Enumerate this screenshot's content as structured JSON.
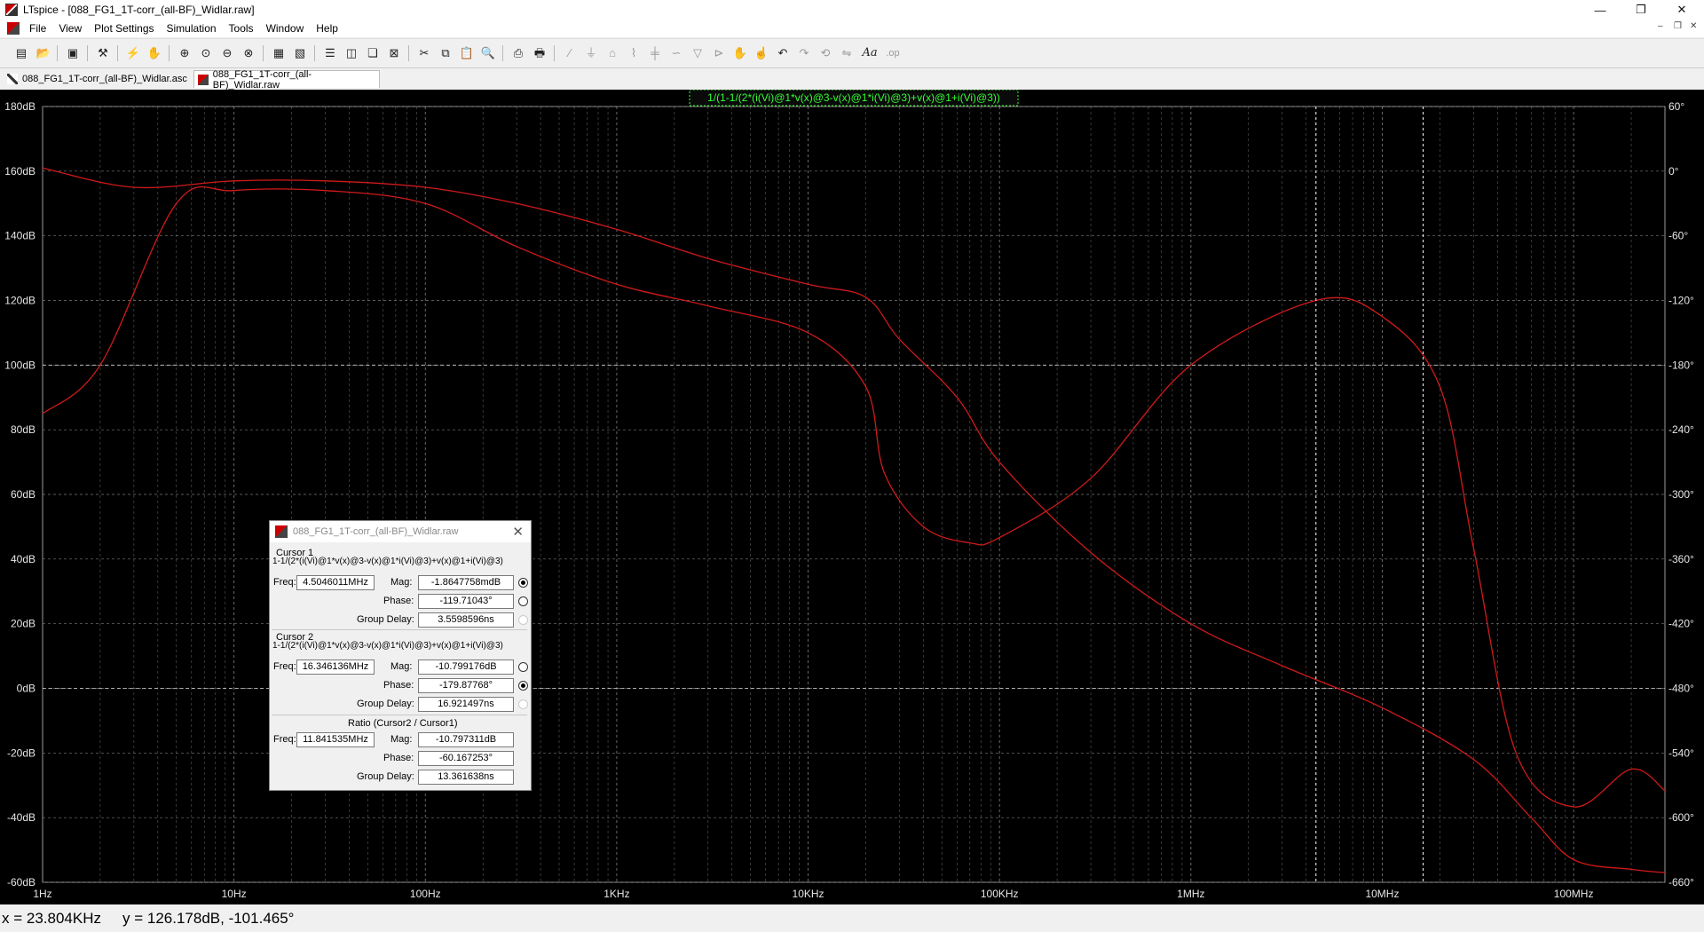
{
  "window": {
    "title": "LTspice - [088_FG1_1T-corr_(all-BF)_Widlar.raw]",
    "minimize": "—",
    "restore": "❐",
    "close": "✕"
  },
  "menu": [
    "File",
    "View",
    "Plot Settings",
    "Simulation",
    "Tools",
    "Window",
    "Help"
  ],
  "mdi_controls": {
    "minimize": "–",
    "restore": "❐",
    "close": "✕"
  },
  "tabs": [
    {
      "label": "088_FG1_1T-corr_(all-BF)_Widlar.asc",
      "icon": "schematic-icon"
    },
    {
      "label": "088_FG1_1T-corr_(all-BF)_Widlar.raw",
      "icon": "waveform-icon"
    }
  ],
  "toolbar_icons": [
    "new-schematic-icon",
    "open-icon",
    "save-icon",
    "control-panel-icon",
    "run-icon",
    "halt-icon",
    "zoom-in-icon",
    "zoom-pan-icon",
    "zoom-out-icon",
    "zoom-cancel-icon",
    "autorange-icon",
    "manual-limits-icon",
    "tile-horizontal-icon",
    "tile-vertical-icon",
    "cascade-icon",
    "close-all-icon",
    "cut-icon",
    "copy-icon",
    "paste-icon",
    "find-icon",
    "print-setup-icon",
    "print-icon",
    "wire-icon",
    "ground-icon",
    "label-icon",
    "resistor-icon",
    "capacitor-icon",
    "inductor-icon",
    "diode-icon",
    "component-icon",
    "move-icon",
    "drag-icon",
    "undo-icon",
    "redo-icon",
    "rotate-icon",
    "mirror-icon",
    "text-icon",
    "spice-directive-icon"
  ],
  "plot": {
    "trace_label": "1/(1-1/(2*(i(Vi)@1*v(x)@3-v(x)@1*i(Vi)@3)+v(x)@1+i(Vi)@3))",
    "left_ticks": [
      "180dB",
      "160dB",
      "140dB",
      "120dB",
      "100dB",
      "80dB",
      "60dB",
      "40dB",
      "20dB",
      "0dB",
      "-20dB",
      "-40dB",
      "-60dB"
    ],
    "right_ticks": [
      "60°",
      "0°",
      "-60°",
      "-120°",
      "-180°",
      "-240°",
      "-300°",
      "-360°",
      "-420°",
      "-480°",
      "-540°",
      "-600°",
      "-660°"
    ],
    "x_ticks": [
      "1Hz",
      "10Hz",
      "100Hz",
      "1KHz",
      "10KHz",
      "100KHz",
      "1MHz",
      "10MHz",
      "100MHz"
    ],
    "colors": {
      "background": "#000000",
      "grid": "#7a7a7a",
      "trace": "#d01a1a",
      "label": "#33ff33",
      "axis_text": "#e6e6e6"
    }
  },
  "chart_data": {
    "type": "line",
    "x_scale": "log",
    "xlim": [
      1,
      300000000
    ],
    "ylim_left": [
      -60,
      180
    ],
    "ylim_right": [
      -660,
      60
    ],
    "series": [
      {
        "axis": "left",
        "points": [
          [
            1,
            161
          ],
          [
            3,
            155
          ],
          [
            10,
            157
          ],
          [
            30,
            157
          ],
          [
            100,
            155
          ],
          [
            300,
            150
          ],
          [
            1000,
            142
          ],
          [
            3000,
            133
          ],
          [
            10000,
            125
          ],
          [
            20000,
            121
          ],
          [
            30000,
            108
          ],
          [
            60000,
            90
          ],
          [
            100000,
            70
          ],
          [
            300000,
            42
          ],
          [
            1000000,
            20
          ],
          [
            3000000,
            7
          ],
          [
            10000000,
            -6
          ],
          [
            30000000,
            -22
          ],
          [
            60000000,
            -40
          ],
          [
            100000000,
            -53
          ],
          [
            200000000,
            -56
          ],
          [
            300000000,
            -57
          ]
        ]
      },
      {
        "axis": "right",
        "points": [
          [
            1,
            -225
          ],
          [
            2,
            -180
          ],
          [
            5,
            -30
          ],
          [
            10,
            -18
          ],
          [
            30,
            -18
          ],
          [
            100,
            -30
          ],
          [
            300,
            -70
          ],
          [
            1000,
            -105
          ],
          [
            3000,
            -125
          ],
          [
            10000,
            -150
          ],
          [
            20000,
            -200
          ],
          [
            25000,
            -280
          ],
          [
            40000,
            -330
          ],
          [
            70000,
            -345
          ],
          [
            100000,
            -340
          ],
          [
            300000,
            -285
          ],
          [
            1000000,
            -180
          ],
          [
            4500000,
            -120
          ],
          [
            10000000,
            -135
          ],
          [
            20000000,
            -200
          ],
          [
            30000000,
            -350
          ],
          [
            50000000,
            -540
          ],
          [
            100000000,
            -590
          ],
          [
            200000000,
            -555
          ],
          [
            300000000,
            -575
          ]
        ]
      }
    ]
  },
  "cursor_dialog": {
    "title": "088_FG1_1T-corr_(all-BF)_Widlar.raw",
    "cursor1": {
      "heading": "Cursor 1",
      "trace": "1-1/(2*(i(Vi)@1*v(x)@3-v(x)@1*i(Vi)@3)+v(x)@1+i(Vi)@3)",
      "freq": "4.5046011MHz",
      "mag": "-1.8647758mdB",
      "phase": "-119.71043°",
      "group_delay": "3.5598596ns"
    },
    "cursor2": {
      "heading": "Cursor 2",
      "trace": "1-1/(2*(i(Vi)@1*v(x)@3-v(x)@1*i(Vi)@3)+v(x)@1+i(Vi)@3)",
      "freq": "16.346136MHz",
      "mag": "-10.799176dB",
      "phase": "-179.87768°",
      "group_delay": "16.921497ns"
    },
    "ratio": {
      "heading": "Ratio (Cursor2 / Cursor1)",
      "freq": "11.841535MHz",
      "mag": "-10.797311dB",
      "phase": "-60.167253°",
      "group_delay": "13.361638ns"
    },
    "labels": {
      "freq": "Freq:",
      "mag": "Mag:",
      "phase": "Phase:",
      "group_delay": "Group Delay:"
    }
  },
  "status": {
    "x": "x = 23.804KHz",
    "y": "y = 126.178dB, -101.465°"
  }
}
